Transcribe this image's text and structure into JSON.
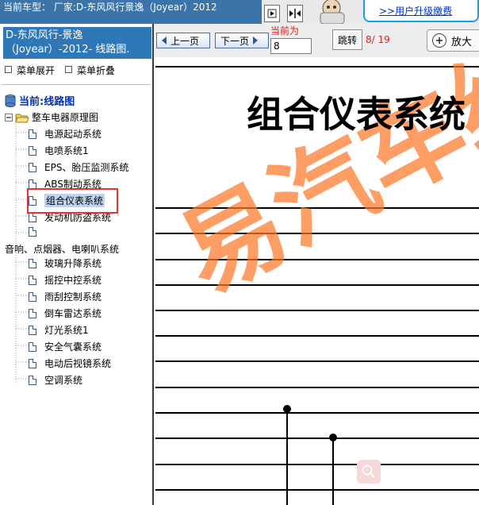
{
  "header": {
    "vehicle_info": "当前车型： 厂家:D-东风风行景逸（Joyear）2012",
    "upgrade_link": ">>用户升级缴费"
  },
  "sidebar": {
    "model_title_line1": "D-东风风行-景逸",
    "model_title_line2": "（Joyear）-2012- 线路图.",
    "expand_label": "菜单展开",
    "collapse_label": "菜单折叠",
    "current_label": "当前:线路图",
    "root_node": "整车电器原理图",
    "items": [
      {
        "label": "电源起动系统"
      },
      {
        "label": "电喷系统1"
      },
      {
        "label": "EPS、胎压监测系统"
      },
      {
        "label": "ABS制动系统"
      },
      {
        "label": "组合仪表系统"
      },
      {
        "label": "发动机防盗系统"
      },
      {
        "label": ""
      },
      {
        "label": "玻璃升降系统"
      },
      {
        "label": "摇控中控系统"
      },
      {
        "label": "雨刮控制系统"
      },
      {
        "label": "倒车雷达系统"
      },
      {
        "label": "灯光系统1"
      },
      {
        "label": "安全气囊系统"
      },
      {
        "label": "电动后视镜系统"
      },
      {
        "label": "空调系统"
      }
    ],
    "orphan_item": "音响、点烟器、电喇叭系统",
    "selected_index": 4
  },
  "toolbar": {
    "prev_label": "上一页",
    "next_label": "下一页",
    "current_label": "当前为",
    "page_value": "8",
    "jump_label": "跳转",
    "page_count": "8/ 19",
    "zoom_label": "放大"
  },
  "diagram": {
    "title": "组合仪表系统",
    "watermark": "易汽车维"
  },
  "colors": {
    "accent_blue": "#2f78b8",
    "highlight_red": "#e53232",
    "page_red": "#e0201e",
    "watermark_orange": "#ff7828"
  }
}
